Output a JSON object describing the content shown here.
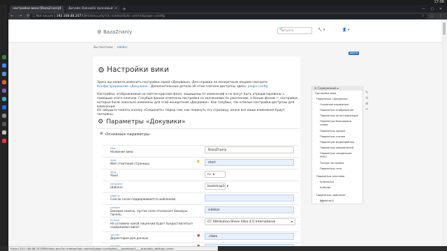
{
  "os": {
    "clock": "17:06"
  },
  "browser": {
    "tabs": [
      {
        "title": "настройки вики [BazaZnaniy]"
      },
      {
        "title": "Дизайн Dokuwiki красивый ..."
      }
    ],
    "new_tab": "+",
    "window_controls": "— ▢ ✕",
    "nav": "← → ⟳",
    "security": "ⓘ Not secure",
    "url_host": "192.168.88.207",
    "url_path": "/ЕВН/doku.php?id=sidebar&do=admin&page=config",
    "extensions": "☆ ⬚ ⋮"
  },
  "header": {
    "logo_icon": "⚙",
    "logo": "BazaZnaniy",
    "search_placeholder": "Найти",
    "search_icon": "🔍",
    "tools": "🔧 ▾",
    "user": "👤 ▾"
  },
  "trail": {
    "prefix": "Вы посетили:",
    "link": "sidebar"
  },
  "admin_badge": "admin",
  "page": {
    "title": "Настройки вики",
    "p1": "Здесь вы можете изменить настройки своей «Докувики». Для справки по конкретным опциям смотрите",
    "p1_link": "Конфигурирование «Докувики»",
    "p1_tail": ". Дополнительные детали об этом плагине доступны здесь:",
    "p1_link2": "plugin:config",
    "p2": "Настройки, отображаемые на светло-красном фоне, защищены от изменений и не могут быть отредактированы с помощью этого плагина. Голубым фоном отмечены настройки со значениями по умолчанию, а белым фоном — настройки, которые были локально изменены для этой конкретной «Докувики». Как голубые, так и белые настройки доступны для изменения.",
    "p3": "Не забудьте нажать кнопку «Сохранить» перед тем, как покинуть эту страницу, иначе все ваши изменения будут потеряны.",
    "h2": "Параметры «Докувики»",
    "section": "Основные параметры"
  },
  "settings": [
    {
      "key": "title",
      "label": "Название вики",
      "value": "BazaZnaniy",
      "kind": "plain"
    },
    {
      "key": "start",
      "label": "Имя стартовой страницы",
      "value": "start",
      "kind": "default",
      "warn": true
    },
    {
      "key": "lang",
      "label": "Язык",
      "value": "ru",
      "kind": "select"
    },
    {
      "key": "template",
      "label": "Шаблон",
      "value": "bootstrap3",
      "kind": "select"
    },
    {
      "key": "tagline",
      "label": "Слоган (если поддерживается шаблоном)",
      "value": "",
      "kind": "default"
    },
    {
      "key": "sidebar",
      "label": "Боковая панель, пустое поле отключает боковую панель.",
      "value": "sidebar",
      "kind": "default"
    },
    {
      "key": "license",
      "label": "На условиях какой лицензии будет предоставляться содержимое вики?",
      "value": "CC Attribution-Share Alike 4.0 International",
      "kind": "select"
    },
    {
      "key": "savedir",
      "label": "Директория для данных",
      "value": "./data",
      "kind": "default",
      "err": true
    },
    {
      "key": "basedir",
      "label": "",
      "value": "",
      "kind": "default",
      "err": true
    }
  ],
  "toc": {
    "header": "Содержание",
    "items": [
      "Настройки вики",
      "Параметры «Докувики»",
      "Основные параметры",
      "Параметры отображения",
      "Параметры аутентификации",
      "Параметры блокировки спама",
      "Параметры правки",
      "Параметры ссылок",
      "Параметры медиафайлов",
      "Параметры уведомлений",
      "Параметры синдикации (RSS)",
      "Тонкая настройка",
      "Параметры сети",
      "Параметры плагинов",
      "Indexmenu",
      "Authpdo",
      "Параметры шаблонов",
      "Bootstrap3"
    ]
  },
  "side_icons": [
    "✎",
    "⟲",
    "⚙",
    "✂"
  ],
  "status_bar": "https://192.168.88.207/ЕВН/doku.php?id=sidebar&do=admin&page=config#tpl___bootstrap3____template_settings_name"
}
